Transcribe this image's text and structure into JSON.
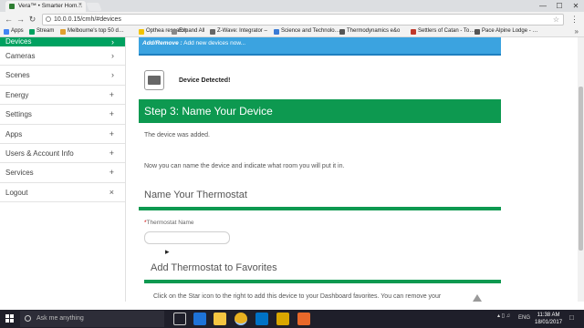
{
  "browser": {
    "tab_title": "Vera™ • Smarter Hom…",
    "tab_close": "×",
    "window_controls": [
      "—",
      "☐",
      "✕"
    ],
    "url": "10.0.0.15/cmh/#devices",
    "nav": {
      "back": "←",
      "forward": "→",
      "reload": "↻"
    },
    "star": "☆",
    "menu": "⋮",
    "bookmarks": [
      {
        "label": "Apps",
        "icon": "apps-grid-icon",
        "color": "#4285f4"
      },
      {
        "label": "Stream",
        "icon": "stream-icon",
        "color": "#00a160"
      },
      {
        "label": "Melbourne's top 50 d…",
        "icon": "page-icon",
        "color": "#e0a030"
      },
      {
        "label": "Opthea research",
        "icon": "folder-icon",
        "color": "#f2c200"
      },
      {
        "label": "Expand All",
        "icon": "bookmarklet-icon",
        "color": "#888888"
      },
      {
        "label": "Z-Wave: Integrator –",
        "icon": "page-icon",
        "color": "#666666"
      },
      {
        "label": "Science and Technolo…",
        "icon": "page-icon",
        "color": "#3a7bd5"
      },
      {
        "label": "Thermodynamics e&o",
        "icon": "page-icon",
        "color": "#555555"
      },
      {
        "label": "Settlers of Catan - To…",
        "icon": "page-icon",
        "color": "#c0392b"
      },
      {
        "label": "Pace Alpine Lodge - …",
        "icon": "page-icon",
        "color": "#555555"
      }
    ],
    "bookmarks_more": "»"
  },
  "sidebar": {
    "items": [
      {
        "label": "Devices",
        "glyph": "›",
        "active": true
      },
      {
        "label": "Cameras",
        "glyph": "›"
      },
      {
        "label": "Scenes",
        "glyph": "›"
      },
      {
        "label": "Energy",
        "glyph": "+"
      },
      {
        "label": "Settings",
        "glyph": "+"
      },
      {
        "label": "Apps",
        "glyph": "+"
      },
      {
        "label": "Users & Account Info",
        "glyph": "+"
      },
      {
        "label": "Services",
        "glyph": "+"
      },
      {
        "label": "Logout",
        "glyph": "×"
      }
    ]
  },
  "main": {
    "header_title": "Add/Remove :",
    "header_subtitle": " Add new devices now...",
    "detected_text": "Device Detected!",
    "step_title": "Step 3: Name Your Device",
    "added_text": "The device was added.",
    "instruction_text": "Now you can name the device and indicate what room you will put it in.",
    "name_section_title": "Name Your Thermostat",
    "field_required_mark": "*",
    "field_label": "Thermostat Name",
    "field_value": "",
    "favorites_title": "Add Thermostat to Favorites",
    "favorites_text": "Click on the Star icon to the right to add this device to your Dashboard favorites. You can remove your"
  },
  "taskbar": {
    "search_placeholder": "Ask me anything",
    "language": "ENG",
    "time": "11:38 AM",
    "date": "18/01/2017"
  },
  "colors": {
    "accent_green": "#0d9950",
    "header_blue": "#3ba3e0",
    "sidebar_active": "#00a160"
  }
}
